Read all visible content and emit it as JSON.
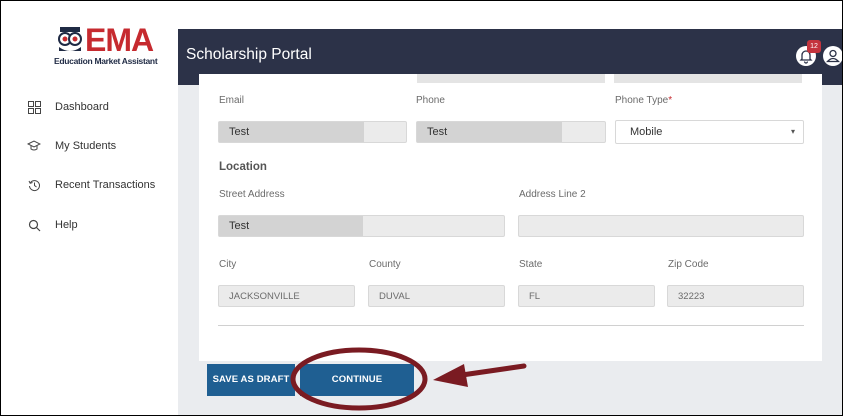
{
  "brand": {
    "logo_text": "EMA",
    "logo_subtitle": "Education Market Assistant",
    "brand_color": "#c62a2f"
  },
  "sidebar": {
    "items": [
      {
        "label": "Dashboard",
        "icon": "dashboard-grid-icon"
      },
      {
        "label": "My Students",
        "icon": "graduation-cap-icon"
      },
      {
        "label": "Recent Transactions",
        "icon": "history-icon"
      },
      {
        "label": "Help",
        "icon": "search-icon"
      }
    ]
  },
  "header": {
    "title": "Scholarship Portal",
    "notification_count": "12",
    "background": "#2c3248"
  },
  "form": {
    "email_label": "Email",
    "email_value": "Test",
    "phone_label": "Phone",
    "phone_value": "Test",
    "phone_type_label": "Phone Type",
    "phone_type_required": "*",
    "phone_type_value": "Mobile",
    "location_title": "Location",
    "street_label": "Street Address",
    "street_value": "Test",
    "address2_label": "Address Line 2",
    "address2_value": "",
    "city_label": "City",
    "city_value": "JACKSONVILLE",
    "county_label": "County",
    "county_value": "DUVAL",
    "state_label": "State",
    "state_value": "FL",
    "zip_label": "Zip Code",
    "zip_value": "32223"
  },
  "actions": {
    "save_draft_label": "SAVE AS DRAFT",
    "continue_label": "CONTINUE",
    "button_color": "#1f5f92"
  },
  "annotation": {
    "color": "#7a1b22"
  }
}
